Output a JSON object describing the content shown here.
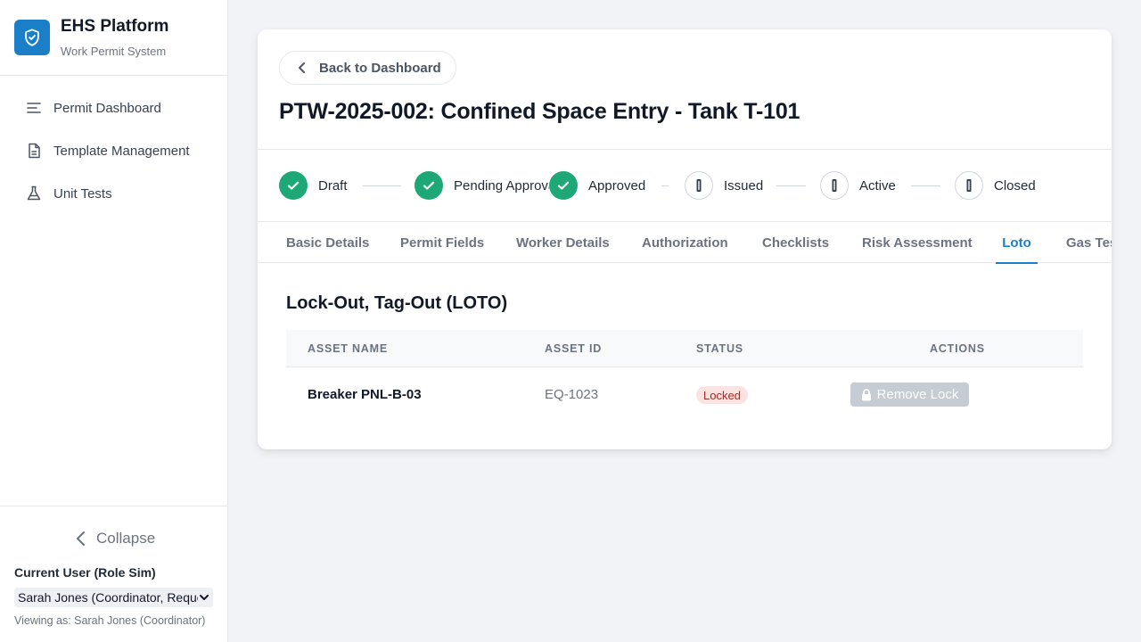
{
  "app": {
    "title": "EHS Platform",
    "subtitle": "Work Permit System",
    "accent_color": "#1a7fc6"
  },
  "sidebar": {
    "items": [
      {
        "label": "Permit Dashboard",
        "icon": "lines-icon"
      },
      {
        "label": "Template Management",
        "icon": "document-icon"
      },
      {
        "label": "Unit Tests",
        "icon": "flask-icon"
      }
    ],
    "collapse_label": "Collapse",
    "current_user_label": "Current User (Role Sim)",
    "current_user_value": "Sarah Jones (Coordinator, Requester)",
    "viewing_as": "Viewing as: Sarah Jones (Coordinator)"
  },
  "header": {
    "back_label": "Back to Dashboard",
    "title": "PTW-2025-002: Confined Space Entry - Tank T-101"
  },
  "stepper": {
    "steps": [
      {
        "label": "Draft",
        "status": "done"
      },
      {
        "label": "Pending Approval",
        "status": "done"
      },
      {
        "label": "Approved",
        "status": "done"
      },
      {
        "label": "Issued",
        "status": "pending"
      },
      {
        "label": "Active",
        "status": "pending"
      },
      {
        "label": "Closed",
        "status": "pending"
      }
    ],
    "done_color": "#1ea877"
  },
  "tabs": [
    {
      "label": "Basic Details",
      "active": false
    },
    {
      "label": "Permit Fields",
      "active": false
    },
    {
      "label": "Worker Details",
      "active": false
    },
    {
      "label": "Authorization",
      "active": false
    },
    {
      "label": "Checklists",
      "active": false
    },
    {
      "label": "Risk Assessment",
      "active": false
    },
    {
      "label": "Loto",
      "active": true
    },
    {
      "label": "Gas Tests",
      "active": false
    }
  ],
  "loto": {
    "title": "Lock-Out, Tag-Out (LOTO)",
    "columns": [
      "ASSET NAME",
      "ASSET ID",
      "STATUS",
      "ACTIONS"
    ],
    "rows": [
      {
        "asset_name": "Breaker PNL-B-03",
        "asset_id": "EQ-1023",
        "status": "Locked",
        "action_label": "Remove Lock"
      }
    ]
  }
}
